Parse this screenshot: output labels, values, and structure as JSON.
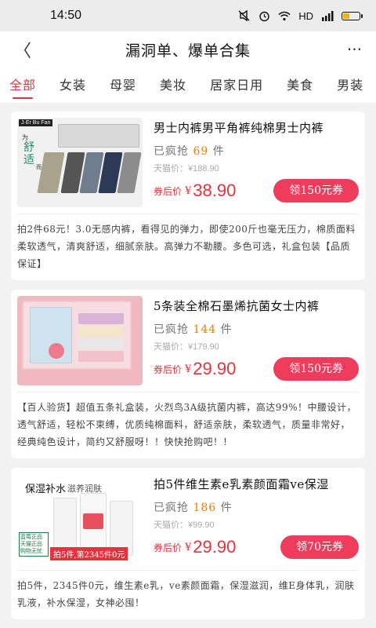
{
  "status": {
    "time": "14:50",
    "icons_text": "HD",
    "wifi": "wifi-icon",
    "alarm": "alarm-icon",
    "signal": "signal-icon",
    "battery_level": 0.4
  },
  "nav": {
    "title": "漏洞单、爆单合集",
    "back_icon": "back-chevron-icon",
    "more_icon": "more-dots-icon"
  },
  "tabs": [
    "全部",
    "女装",
    "母婴",
    "美妆",
    "居家日用",
    "美食",
    "男装"
  ],
  "active_tab": 0,
  "products": [
    {
      "title": "男士内裤男平角裤纯棉男士内裤",
      "sold_prefix": "已疯抢",
      "sold_count": "69",
      "sold_suffix": "件",
      "orig_price": "天猫价：¥188.90",
      "after_label": "券后价",
      "yen": "¥",
      "price": "38.90",
      "coupon": "领150元券",
      "desc": "拍2件68元！3.0无感内裤，看得见的弹力，即使200斤也毫无压力，棉质面料柔软透气，清爽舒适，细腻亲肤。高弹力不勒腰。多色可选，礼盒包装【品质保证】",
      "thumb": {
        "brand": "J·Er Bu Fan",
        "line1": "为",
        "line2": "舒\n适",
        "line3": "而生"
      }
    },
    {
      "title": "5条装全棉石墨烯抗菌女士内裤",
      "sold_prefix": "已疯抢",
      "sold_count": "144",
      "sold_suffix": "件",
      "orig_price": "天猫价：¥179.90",
      "after_label": "券后价",
      "yen": "¥",
      "price": "29.90",
      "coupon": "领150元券",
      "desc": "【百人验货】超值五条礼盒装，火烈鸟3A级抗菌内裤，高达99%！中腰设计，透气舒适，轻松不束缚，优质纯棉面料，舒适亲肤，柔软透气，质量非常好，经典纯色设计，简约又舒服呀！！快快抢购吧！！",
      "thumb": {}
    },
    {
      "title": "拍5件维生素e乳素颜面霜ve保湿",
      "sold_prefix": "已疯抢",
      "sold_count": "186",
      "sold_suffix": "件",
      "orig_price": "天猫价：¥99.90",
      "after_label": "券后价",
      "yen": "¥",
      "price": "29.90",
      "coupon": "领70元券",
      "desc": "拍5件，2345件0元，维生素e乳，ve素颜面霜，保湿滋润，维E身体乳，润肤乳液，补水保湿，女神必囤！",
      "thumb": {
        "line1": "保湿补水",
        "line2": "滋养润肤",
        "line3": "蓝莓正品\n天猫正品\n购物无忧",
        "line4": "拍5件,第2345件0元"
      }
    }
  ]
}
